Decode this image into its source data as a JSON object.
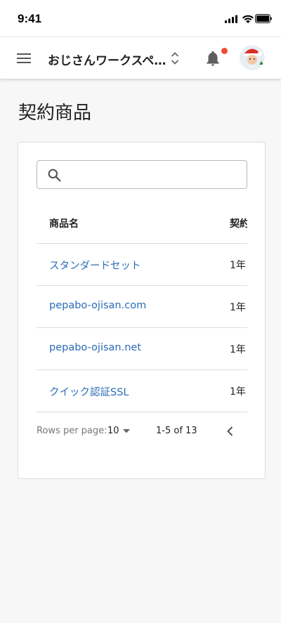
{
  "status_bar": {
    "time": "9:41"
  },
  "header": {
    "workspace_title": "おじさんワークスペース",
    "icons": [
      "menu-icon",
      "unfold-icon",
      "bell-icon",
      "avatar"
    ],
    "notification_dot_color": "#ef4b33"
  },
  "page": {
    "title": "契約商品"
  },
  "search": {
    "placeholder": "",
    "value": ""
  },
  "table": {
    "columns": [
      "商品名",
      "契約期間"
    ],
    "rows": [
      {
        "name": "スタンダードセット",
        "term": "1年"
      },
      {
        "name": "pepabo-ojisan.com",
        "term": "1年"
      },
      {
        "name": "pepabo-ojisan.net",
        "term": "1年"
      },
      {
        "name": "クイック認証SSL",
        "term": "1年"
      }
    ]
  },
  "pagination": {
    "rows_per_page_label": "Rows per page:",
    "rows_per_page": "10",
    "range": "1-5 of 13"
  },
  "colors": {
    "link": "#2b6cb8",
    "accent_dot": "#ef4b33"
  }
}
